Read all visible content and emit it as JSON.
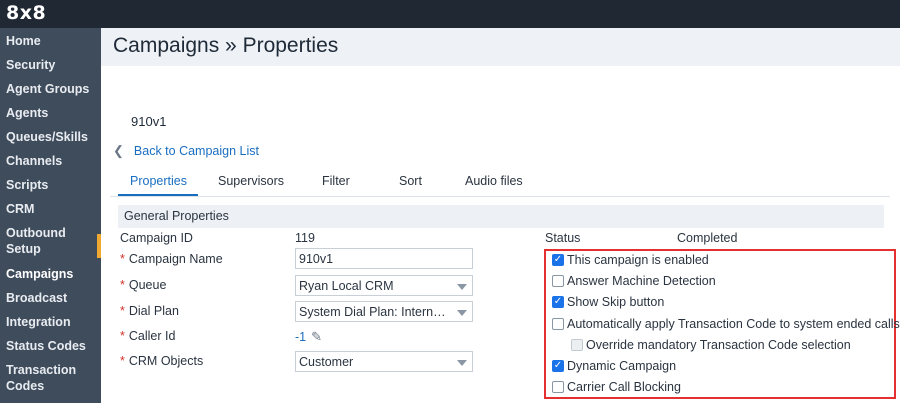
{
  "brand": {
    "logo": "8x8"
  },
  "sidebar": {
    "items": [
      {
        "label": "Home"
      },
      {
        "label": "Security"
      },
      {
        "label": "Agent Groups"
      },
      {
        "label": "Agents"
      },
      {
        "label": "Queues/Skills"
      },
      {
        "label": "Channels"
      },
      {
        "label": "Scripts"
      },
      {
        "label": "CRM"
      },
      {
        "label": "Outbound Setup"
      },
      {
        "label": "Campaigns",
        "active": true
      },
      {
        "label": "Broadcast"
      },
      {
        "label": "Integration"
      },
      {
        "label": "Status Codes"
      },
      {
        "label": "Transaction Codes"
      }
    ]
  },
  "header": {
    "title": "Campaigns » Properties"
  },
  "campaign_name_display": "910v1",
  "back_link": {
    "icon": "chevron-left-icon",
    "label": "Back to Campaign List"
  },
  "tabs": [
    {
      "label": "Properties",
      "active": true
    },
    {
      "label": "Supervisors"
    },
    {
      "label": "Filter"
    },
    {
      "label": "Sort"
    },
    {
      "label": "Audio files"
    }
  ],
  "section": {
    "title": "General Properties"
  },
  "form": {
    "campaign_id": {
      "label": "Campaign ID",
      "value": "119"
    },
    "campaign_name": {
      "required": "*",
      "label": "Campaign Name",
      "value": "910v1"
    },
    "queue": {
      "required": "*",
      "label": "Queue",
      "value": "Ryan Local CRM"
    },
    "dial_plan": {
      "required": "*",
      "label": "Dial Plan",
      "value": "System Dial Plan: Internat..."
    },
    "caller_id": {
      "required": "*",
      "label": "Caller Id",
      "value": "-1",
      "icon": "pencil-icon"
    },
    "crm_objects": {
      "required": "*",
      "label": "CRM Objects",
      "value": "Customer"
    }
  },
  "status": {
    "label": "Status",
    "value": "Completed"
  },
  "checkboxes": [
    {
      "label": "This campaign is enabled",
      "checked": true
    },
    {
      "label": "Answer Machine Detection",
      "checked": false
    },
    {
      "label": "Show Skip button",
      "checked": true
    },
    {
      "label": "Automatically apply Transaction Code to system ended calls",
      "checked": false
    },
    {
      "label": "Override mandatory Transaction Code selection",
      "checked": false,
      "disabled": true
    },
    {
      "label": "Dynamic Campaign",
      "checked": true
    },
    {
      "label": "Carrier Call Blocking",
      "checked": false
    }
  ],
  "colors": {
    "accent": "#1a6ec0",
    "sidebar": "#3f4c5c",
    "topbar": "#202833",
    "highlight_box": "#e53030",
    "checkbox_checked": "#1a73e8"
  }
}
